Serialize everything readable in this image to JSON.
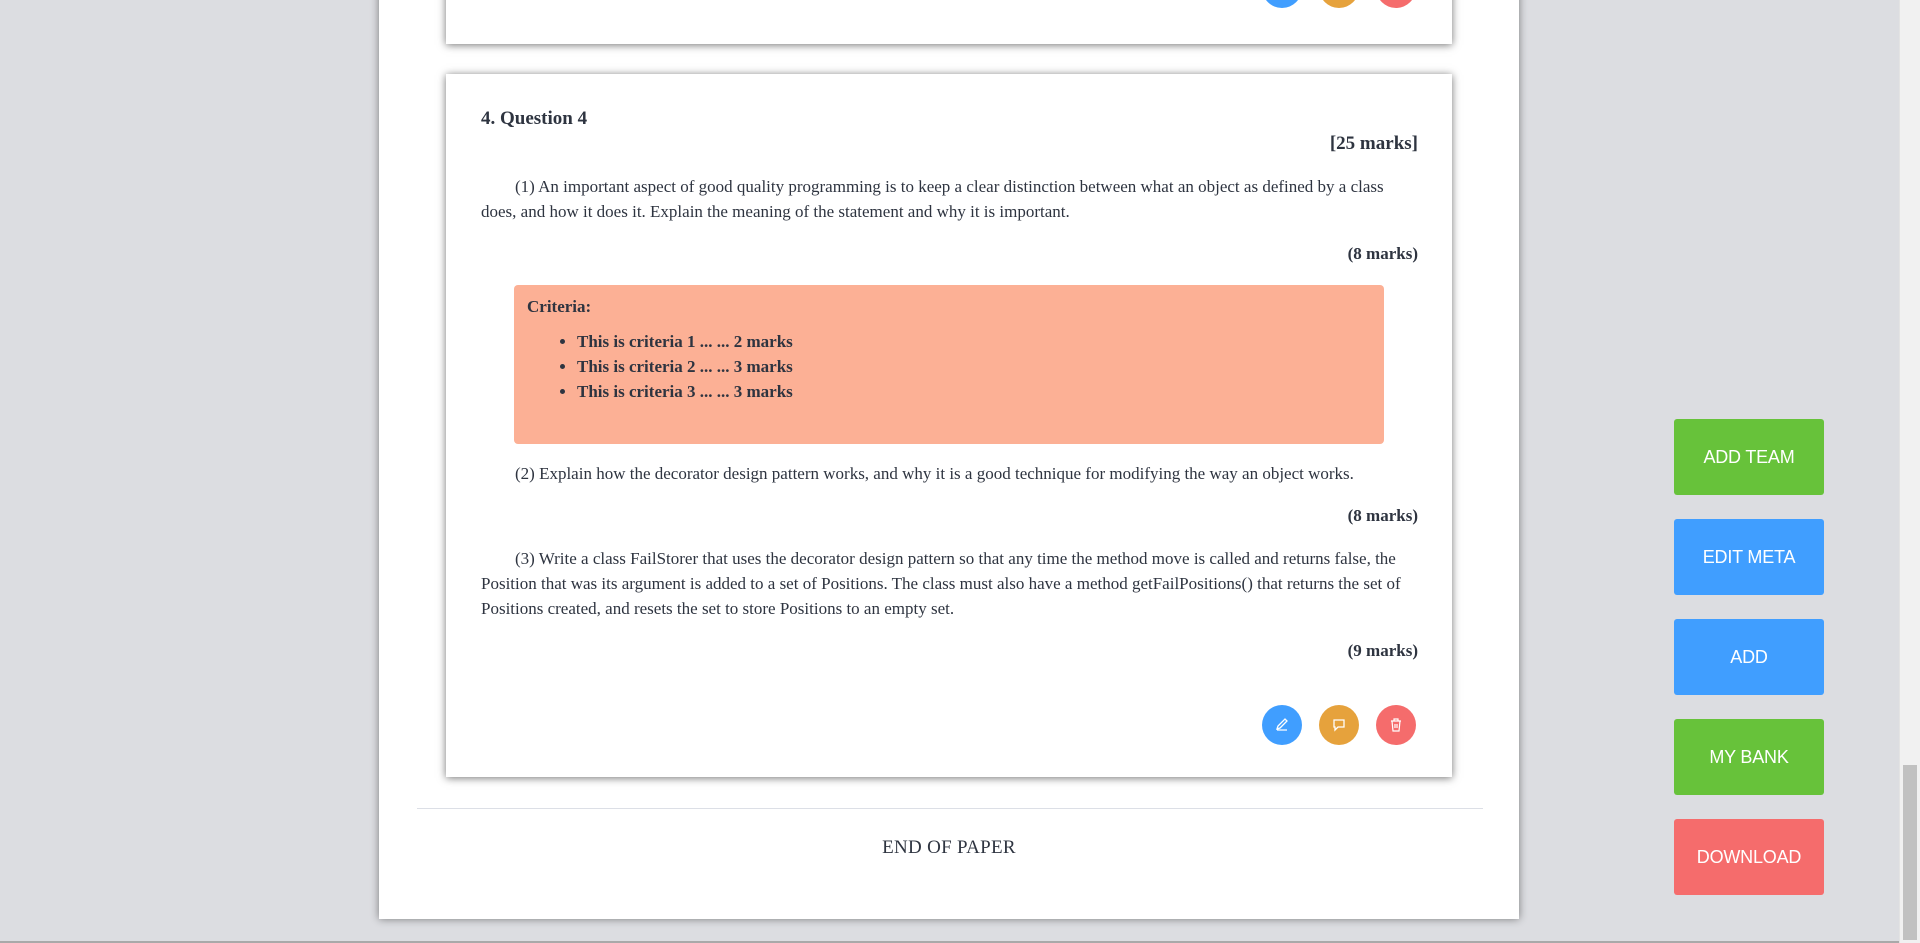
{
  "question": {
    "title": "4. Question 4",
    "total_marks": "[25 marks]",
    "parts": [
      {
        "text": "(1) An important aspect of good quality programming is to keep a clear distinction between what an object as defined by a class does, and how it does it. Explain the meaning of the statement and why it is important.",
        "marks": "(8 marks)"
      },
      {
        "text": "(2) Explain how the decorator design pattern works, and why it is a good technique for modifying the way an object works.",
        "marks": "(8 marks)"
      },
      {
        "text": "(3) Write a class FailStorer that uses the decorator design pattern so that any time the method move is called and returns false, the Position that was its argument is added to a set of Positions. The class must also have a method getFailPositions() that returns the set of Positions created, and resets the set to store Positions to an empty set.",
        "marks": "(9 marks)"
      }
    ],
    "criteria": {
      "title": "Criteria:",
      "items": [
        "This is criteria 1 ... ... 2 marks",
        "This is criteria 2 ... ... 3 marks",
        "This is criteria 3 ... ... 3 marks"
      ]
    },
    "actions": {
      "edit_icon": "pencil-icon",
      "comment_icon": "comment-icon",
      "delete_icon": "trash-icon"
    }
  },
  "footer": {
    "end_text": "END OF PAPER"
  },
  "side_buttons": {
    "add_team": "ADD TEAM",
    "edit_meta": "EDIT META",
    "add": "ADD",
    "my_bank": "MY BANK",
    "download": "DOWNLOAD"
  },
  "colors": {
    "primary": "#409eff",
    "success": "#67c23a",
    "warning": "#e6a23c",
    "danger": "#f56c6c",
    "criteria_bg": "#fcb095"
  }
}
